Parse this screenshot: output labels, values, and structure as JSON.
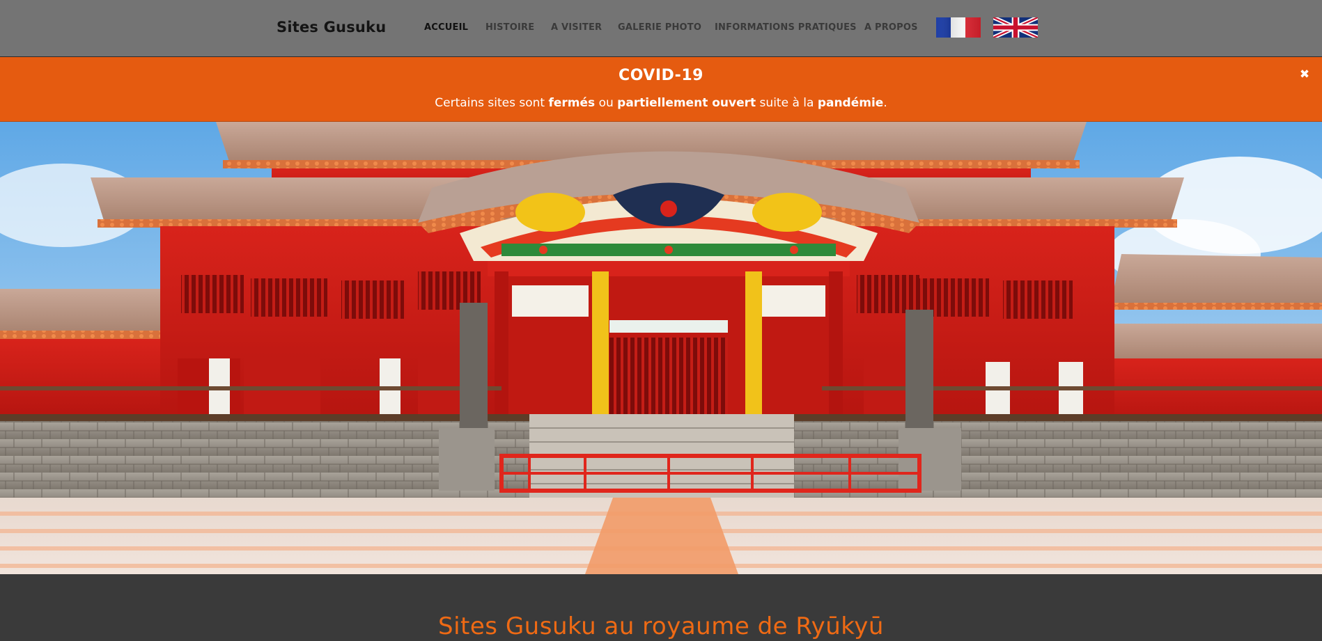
{
  "header": {
    "brand": "Sites Gusuku",
    "nav": [
      {
        "label": "ACCUEIL",
        "active": true
      },
      {
        "label": "HISTOIRE",
        "active": false
      },
      {
        "label": "A VISITER",
        "active": false
      },
      {
        "label": "GALERIE PHOTO",
        "active": false
      },
      {
        "label": "INFORMATIONS PRATIQUES",
        "active": false
      },
      {
        "label": "A PROPOS",
        "active": false
      }
    ],
    "languages": [
      {
        "code": "fr",
        "icon": "french-flag-icon"
      },
      {
        "code": "en",
        "icon": "uk-flag-icon"
      }
    ]
  },
  "banner": {
    "title": "COVID-19",
    "msg_1": "Certains sites sont ",
    "msg_2": "fermés",
    "msg_3": " ou ",
    "msg_4": "partiellement ouvert",
    "msg_5": " suite à la ",
    "msg_6": "pandémie",
    "msg_7": ".",
    "close_icon": "close-icon",
    "close_glyph": "✖"
  },
  "hero": {
    "image": "shuri-castle-photo"
  },
  "content": {
    "title": "Sites Gusuku au royaume de Ryūkyū"
  },
  "colors": {
    "header_bg": "#747474",
    "banner_bg": "#e55b10",
    "accent": "#ef6a14",
    "page_bg": "#3a3a3a"
  }
}
